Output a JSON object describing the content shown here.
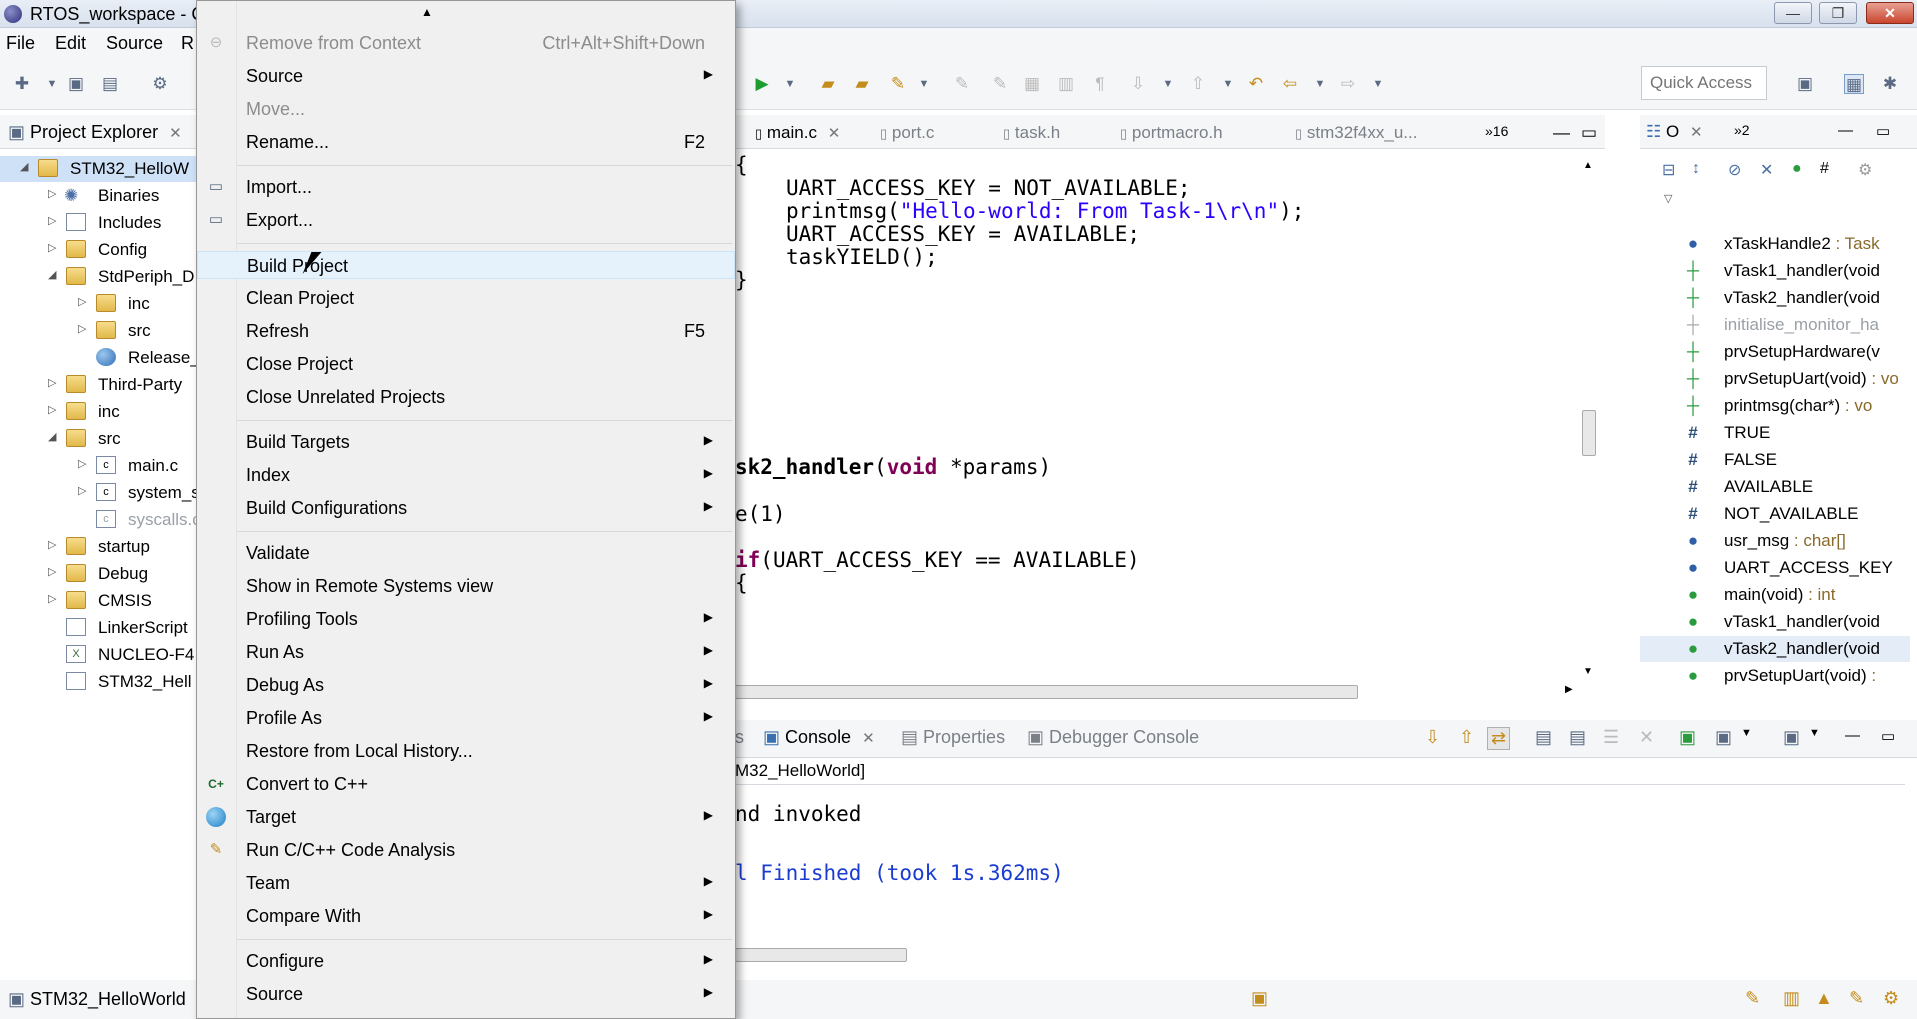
{
  "window": {
    "title": "RTOS_workspace - C",
    "min_label": "—",
    "max_label": "❐",
    "close_label": "✕"
  },
  "menubar": {
    "items": [
      "File",
      "Edit",
      "Source",
      "R"
    ]
  },
  "quick_access": {
    "placeholder": "Quick Access"
  },
  "project_explorer": {
    "tab_label": "Project Explorer",
    "items": [
      {
        "label": "STM32_HelloW",
        "type": "project"
      },
      {
        "label": "Binaries",
        "type": "binaries"
      },
      {
        "label": "Includes",
        "type": "includes"
      },
      {
        "label": "Config",
        "type": "folder"
      },
      {
        "label": "StdPeriph_D",
        "type": "folder"
      },
      {
        "label": "inc",
        "type": "folder"
      },
      {
        "label": "src",
        "type": "folder"
      },
      {
        "label": "Release_",
        "type": "file"
      },
      {
        "label": "Third-Party",
        "type": "folder"
      },
      {
        "label": "inc",
        "type": "folder"
      },
      {
        "label": "src",
        "type": "folder"
      },
      {
        "label": "main.c",
        "type": "c-file"
      },
      {
        "label": "system_s",
        "type": "c-file"
      },
      {
        "label": "syscalls.c",
        "type": "c-file"
      },
      {
        "label": "startup",
        "type": "folder"
      },
      {
        "label": "Debug",
        "type": "folder"
      },
      {
        "label": "CMSIS",
        "type": "folder"
      },
      {
        "label": "LinkerScript",
        "type": "file"
      },
      {
        "label": "NUCLEO-F4",
        "type": "file"
      },
      {
        "label": "STM32_Hell",
        "type": "file"
      }
    ]
  },
  "status_bar": {
    "left_text": "STM32_HelloWorld"
  },
  "editor": {
    "tabs": [
      "main.c",
      "port.c",
      "task.h",
      "portmacro.h",
      "stm32f4xx_u...",
      "16"
    ],
    "code_lines": [
      "{",
      "UART_ACCESS_KEY = NOT_AVAILABLE;",
      "printmsg(",
      "\"Hello-world: From Task-1\\r\\n\"",
      ");",
      "UART_ACCESS_KEY = AVAILABLE;",
      "taskYIELD();",
      "}",
      "sk2_handler",
      "(",
      "void",
      " *params)",
      "e(1)",
      "if",
      "(UART_ACCESS_KEY == AVAILABLE)",
      "{"
    ]
  },
  "outline": {
    "tab_label": "O",
    "overflow_label": "2",
    "items": [
      {
        "name": "xTaskHandle2",
        "type": " : Task",
        "marker": "●",
        "kind": "blue"
      },
      {
        "name": "vTask1_handler(void",
        "type": "",
        "marker": "┼",
        "kind": "green"
      },
      {
        "name": "vTask2_handler(void",
        "type": "",
        "marker": "┼",
        "kind": "green"
      },
      {
        "name": "initialise_monitor_ha",
        "type": "",
        "marker": "┼",
        "kind": "grey"
      },
      {
        "name": "prvSetupHardware(v",
        "type": "",
        "marker": "┼",
        "kind": "green"
      },
      {
        "name": "prvSetupUart(void)",
        "type": " : vo",
        "marker": "┼",
        "kind": "green"
      },
      {
        "name": "printmsg(char*)",
        "type": " : vo",
        "marker": "┼",
        "kind": "green"
      },
      {
        "name": "TRUE",
        "type": "",
        "marker": "#",
        "kind": "hash"
      },
      {
        "name": "FALSE",
        "type": "",
        "marker": "#",
        "kind": "hash"
      },
      {
        "name": "AVAILABLE",
        "type": "",
        "marker": "#",
        "kind": "hash"
      },
      {
        "name": "NOT_AVAILABLE",
        "type": "",
        "marker": "#",
        "kind": "hash"
      },
      {
        "name": "usr_msg",
        "type": " : char[]",
        "marker": "●",
        "kind": "blue"
      },
      {
        "name": "UART_ACCESS_KEY",
        "type": "",
        "marker": "●",
        "kind": "blue"
      },
      {
        "name": "main(void)",
        "type": " : int",
        "marker": "●",
        "kind": "green"
      },
      {
        "name": "vTask1_handler(void",
        "type": "",
        "marker": "●",
        "kind": "green"
      },
      {
        "name": "vTask2_handler(void",
        "type": "",
        "marker": "●",
        "kind": "green"
      },
      {
        "name": "prvSetupUart(void)",
        "type": " : ",
        "marker": "●",
        "kind": "green"
      }
    ]
  },
  "console": {
    "tabs": [
      "s",
      "Console",
      "Properties",
      "Debugger Console"
    ],
    "title": "M32_HelloWorld]",
    "lines": [
      "nd invoked",
      "l Finished (took 1s.362ms)"
    ]
  },
  "context_menu": {
    "scroll_up": "▲",
    "items": [
      {
        "label": "Remove from Context",
        "shortcut": "Ctrl+Alt+Shift+Down",
        "disabled": true,
        "submenu": false,
        "icon": "remove-context-icon"
      },
      {
        "label": "Source",
        "shortcut": "",
        "disabled": false,
        "submenu": true,
        "icon": ""
      },
      {
        "label": "Move...",
        "shortcut": "",
        "disabled": true,
        "submenu": false,
        "icon": ""
      },
      {
        "label": "Rename...",
        "shortcut": "F2",
        "disabled": false,
        "submenu": false,
        "icon": ""
      },
      {
        "label": "Import...",
        "shortcut": "",
        "disabled": false,
        "submenu": false,
        "icon": "import-icon"
      },
      {
        "label": "Export...",
        "shortcut": "",
        "disabled": false,
        "submenu": false,
        "icon": "export-icon"
      },
      {
        "label": "Build Project",
        "shortcut": "",
        "disabled": false,
        "submenu": false,
        "icon": "",
        "hover": true
      },
      {
        "label": "Clean Project",
        "shortcut": "",
        "disabled": false,
        "submenu": false,
        "icon": ""
      },
      {
        "label": "Refresh",
        "shortcut": "F5",
        "disabled": false,
        "submenu": false,
        "icon": ""
      },
      {
        "label": "Close Project",
        "shortcut": "",
        "disabled": false,
        "submenu": false,
        "icon": ""
      },
      {
        "label": "Close Unrelated Projects",
        "shortcut": "",
        "disabled": false,
        "submenu": false,
        "icon": ""
      },
      {
        "label": "Build Targets",
        "shortcut": "",
        "disabled": false,
        "submenu": true,
        "icon": ""
      },
      {
        "label": "Index",
        "shortcut": "",
        "disabled": false,
        "submenu": true,
        "icon": ""
      },
      {
        "label": "Build Configurations",
        "shortcut": "",
        "disabled": false,
        "submenu": true,
        "icon": ""
      },
      {
        "label": "Validate",
        "shortcut": "",
        "disabled": false,
        "submenu": false,
        "icon": ""
      },
      {
        "label": "Show in Remote Systems view",
        "shortcut": "",
        "disabled": false,
        "submenu": false,
        "icon": ""
      },
      {
        "label": "Profiling Tools",
        "shortcut": "",
        "disabled": false,
        "submenu": true,
        "icon": ""
      },
      {
        "label": "Run As",
        "shortcut": "",
        "disabled": false,
        "submenu": true,
        "icon": ""
      },
      {
        "label": "Debug As",
        "shortcut": "",
        "disabled": false,
        "submenu": true,
        "icon": ""
      },
      {
        "label": "Profile As",
        "shortcut": "",
        "disabled": false,
        "submenu": true,
        "icon": ""
      },
      {
        "label": "Restore from Local History...",
        "shortcut": "",
        "disabled": false,
        "submenu": false,
        "icon": ""
      },
      {
        "label": "Convert to C++",
        "shortcut": "",
        "disabled": false,
        "submenu": false,
        "icon": "convert-cpp-icon"
      },
      {
        "label": "Target",
        "shortcut": "",
        "disabled": false,
        "submenu": true,
        "icon": "target-icon"
      },
      {
        "label": "Run C/C++ Code Analysis",
        "shortcut": "",
        "disabled": false,
        "submenu": false,
        "icon": "code-analysis-icon"
      },
      {
        "label": "Team",
        "shortcut": "",
        "disabled": false,
        "submenu": true,
        "icon": ""
      },
      {
        "label": "Compare With",
        "shortcut": "",
        "disabled": false,
        "submenu": true,
        "icon": ""
      },
      {
        "label": "Configure",
        "shortcut": "",
        "disabled": false,
        "submenu": true,
        "icon": ""
      },
      {
        "label": "Source",
        "shortcut": "",
        "disabled": false,
        "submenu": true,
        "icon": ""
      }
    ]
  }
}
